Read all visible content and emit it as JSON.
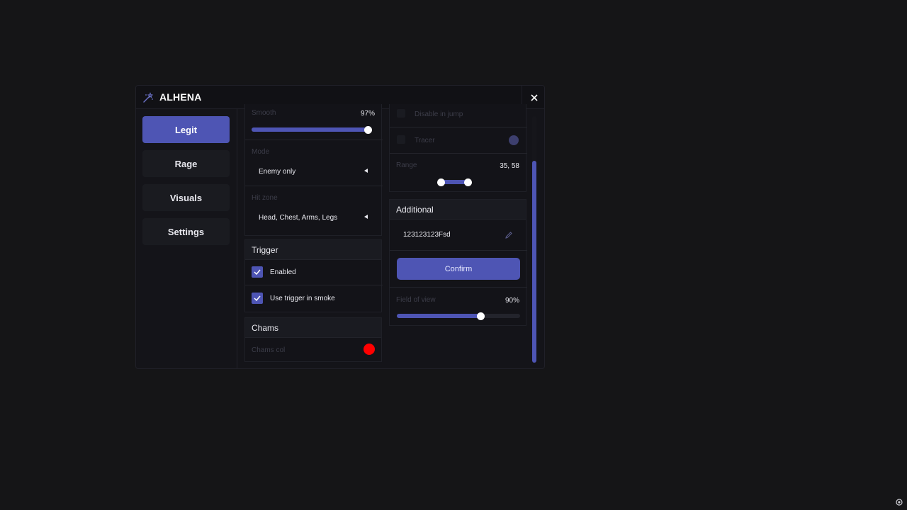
{
  "app": {
    "title": "ALHENA",
    "logo_icon": "magic-wand-icon",
    "close_icon": "close-icon"
  },
  "colors": {
    "accent": "#4e55b4",
    "background": "#151517",
    "window": "#141419",
    "chams": "#ff0000"
  },
  "sidebar": {
    "items": [
      {
        "label": "Legit",
        "active": true
      },
      {
        "label": "Rage",
        "active": false
      },
      {
        "label": "Visuals",
        "active": false
      },
      {
        "label": "Settings",
        "active": false
      }
    ]
  },
  "left_column": {
    "smooth": {
      "label": "Smooth",
      "value_text": "97%",
      "value": 97
    },
    "mode": {
      "label": "Mode",
      "selected": "Enemy only"
    },
    "hitzone": {
      "label": "Hit zone",
      "selected": "Head, Chest, Arms, Legs"
    },
    "trigger": {
      "title": "Trigger",
      "enabled": {
        "label": "Enabled",
        "checked": true
      },
      "smoke": {
        "label": "Use trigger in smoke",
        "checked": true
      }
    },
    "chams": {
      "title": "Chams",
      "color_label": "Chams col"
    }
  },
  "right_column": {
    "disable_in_jump": {
      "label": "Disable in jump"
    },
    "tracer": {
      "label": "Tracer"
    },
    "range": {
      "label": "Range",
      "value_text": "35, 58",
      "min": 35,
      "max": 58
    },
    "additional": {
      "title": "Additional",
      "input_value": "123123123Fsd",
      "edit_icon": "pencil-icon",
      "confirm_label": "Confirm"
    },
    "fov": {
      "label": "Field of view",
      "value_text": "90%",
      "value": 90
    }
  }
}
